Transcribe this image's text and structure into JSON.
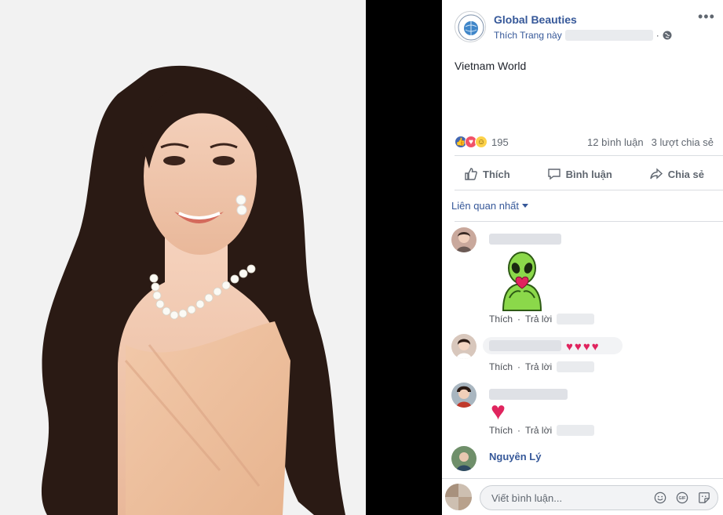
{
  "page": {
    "name": "Global Beauties",
    "like_page": "Thích Trang này",
    "more": "•••"
  },
  "post": {
    "caption": "Vietnam World"
  },
  "stats": {
    "reaction_count": "195",
    "comments": "12 bình luận",
    "shares": "3 lượt chia sẻ"
  },
  "actions": {
    "like": "Thích",
    "comment": "Bình luận",
    "share": "Chia sẻ"
  },
  "sort": {
    "label": "Liên quan nhất"
  },
  "comments": [
    {
      "like": "Thích",
      "reply": "Trả lời"
    },
    {
      "like": "Thích",
      "reply": "Trả lời",
      "hearts": "♥♥♥♥"
    },
    {
      "like": "Thích",
      "reply": "Trả lời",
      "heart": "♥"
    },
    {
      "author": "Nguyên Lý"
    }
  ],
  "composer": {
    "placeholder": "Viết bình luận..."
  },
  "colors": {
    "link": "#365899",
    "brand": "#4267b2",
    "love": "#e0245e",
    "alien_green": "#8bd84a"
  },
  "icons": [
    "globe-icon",
    "more-icon",
    "like-icon",
    "comment-icon",
    "share-icon",
    "emoji-icon",
    "gif-icon",
    "sticker-icon",
    "alien-sticker-icon"
  ]
}
